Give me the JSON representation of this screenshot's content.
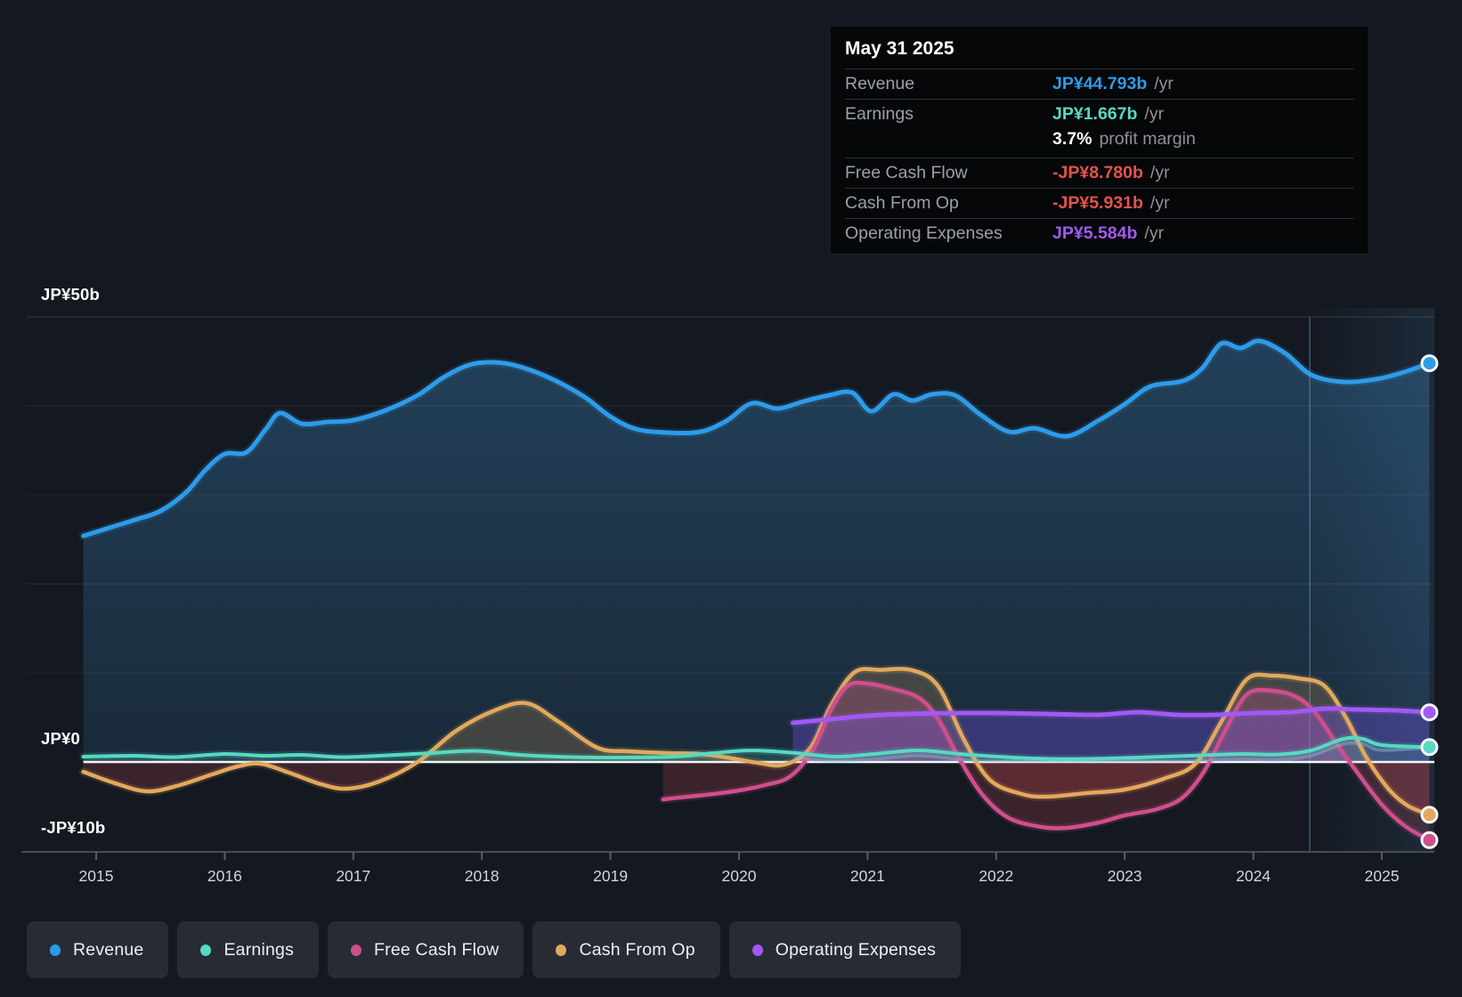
{
  "tooltip": {
    "date": "May 31 2025",
    "rows": [
      {
        "key": "revenue",
        "label": "Revenue",
        "value": "JP¥44.793b",
        "suffix": "/yr",
        "color": "#2e9be9",
        "joined": false
      },
      {
        "key": "earnings",
        "label": "Earnings",
        "value": "JP¥1.667b",
        "suffix": "/yr",
        "color": "#57d9c2",
        "joined": false
      },
      {
        "key": "profit-margin",
        "label": "",
        "value": "3.7%",
        "suffix": "profit margin",
        "color": "#ffffff",
        "joined": true
      },
      {
        "key": "free-cash-flow",
        "label": "Free Cash Flow",
        "value": "-JP¥8.780b",
        "suffix": "/yr",
        "color": "#e4534d",
        "joined": false
      },
      {
        "key": "cash-from-op",
        "label": "Cash From Op",
        "value": "-JP¥5.931b",
        "suffix": "/yr",
        "color": "#e4534d",
        "joined": false
      },
      {
        "key": "operating-expenses",
        "label": "Operating Expenses",
        "value": "JP¥5.584b",
        "suffix": "/yr",
        "color": "#a259f2",
        "joined": false
      }
    ]
  },
  "y_axis": {
    "labels": [
      {
        "text": "JP¥50b",
        "value": 50
      },
      {
        "text": "JP¥0",
        "value": 0
      },
      {
        "text": "-JP¥10b",
        "value": -10
      }
    ]
  },
  "x_axis": {
    "years": [
      "2015",
      "2016",
      "2017",
      "2018",
      "2019",
      "2020",
      "2021",
      "2022",
      "2023",
      "2024",
      "2025"
    ]
  },
  "legend": {
    "items": [
      {
        "key": "revenue",
        "label": "Revenue",
        "color": "#2e9be9"
      },
      {
        "key": "earnings",
        "label": "Earnings",
        "color": "#57d9c2"
      },
      {
        "key": "free-cash-flow",
        "label": "Free Cash Flow",
        "color": "#ce4f8c"
      },
      {
        "key": "cash-from-op",
        "label": "Cash From Op",
        "color": "#e2a85c"
      },
      {
        "key": "operating-expenses",
        "label": "Operating Expenses",
        "color": "#a259f2"
      }
    ]
  },
  "chart_data": {
    "type": "area",
    "unit": "JP¥ billions per year",
    "x_range": [
      2014.9,
      2025.42
    ],
    "ylim": [
      -10.1,
      50
    ],
    "y_gridline_values": [
      50,
      40,
      30,
      20,
      10,
      0,
      -10
    ],
    "y_tick_labels": [
      "JP¥50b",
      "JP¥0",
      "-JP¥10b"
    ],
    "x_tick_labels": [
      "2015",
      "2016",
      "2017",
      "2018",
      "2019",
      "2020",
      "2021",
      "2022",
      "2023",
      "2024",
      "2025"
    ],
    "grid": true,
    "legend_position": "bottom",
    "forecast_divider_x": 2024.44,
    "end_marker_x": 2025.37,
    "series": [
      {
        "name": "Revenue",
        "color": "#2e9be9",
        "points": [
          [
            2014.9,
            25.4
          ],
          [
            2015.1,
            26.3
          ],
          [
            2015.3,
            27.2
          ],
          [
            2015.5,
            28.2
          ],
          [
            2015.7,
            30.3
          ],
          [
            2015.85,
            32.8
          ],
          [
            2016.0,
            34.6
          ],
          [
            2016.17,
            34.8
          ],
          [
            2016.32,
            37.4
          ],
          [
            2016.43,
            39.2
          ],
          [
            2016.6,
            38.0
          ],
          [
            2016.8,
            38.2
          ],
          [
            2017.0,
            38.4
          ],
          [
            2017.25,
            39.5
          ],
          [
            2017.5,
            41.2
          ],
          [
            2017.7,
            43.2
          ],
          [
            2017.9,
            44.6
          ],
          [
            2018.1,
            44.9
          ],
          [
            2018.3,
            44.4
          ],
          [
            2018.55,
            43.0
          ],
          [
            2018.8,
            41.0
          ],
          [
            2019.0,
            38.8
          ],
          [
            2019.2,
            37.4
          ],
          [
            2019.45,
            37.0
          ],
          [
            2019.7,
            37.1
          ],
          [
            2019.9,
            38.3
          ],
          [
            2020.1,
            40.3
          ],
          [
            2020.3,
            39.7
          ],
          [
            2020.5,
            40.5
          ],
          [
            2020.7,
            41.2
          ],
          [
            2020.88,
            41.5
          ],
          [
            2021.03,
            39.4
          ],
          [
            2021.2,
            41.3
          ],
          [
            2021.35,
            40.6
          ],
          [
            2021.5,
            41.3
          ],
          [
            2021.68,
            41.2
          ],
          [
            2021.88,
            39.0
          ],
          [
            2022.1,
            37.1
          ],
          [
            2022.3,
            37.5
          ],
          [
            2022.55,
            36.6
          ],
          [
            2022.8,
            38.4
          ],
          [
            2023.0,
            40.2
          ],
          [
            2023.2,
            42.2
          ],
          [
            2023.45,
            42.8
          ],
          [
            2023.6,
            44.2
          ],
          [
            2023.75,
            47.0
          ],
          [
            2023.9,
            46.5
          ],
          [
            2024.05,
            47.3
          ],
          [
            2024.25,
            45.9
          ],
          [
            2024.45,
            43.5
          ],
          [
            2024.7,
            42.7
          ],
          [
            2024.95,
            43.0
          ],
          [
            2025.15,
            43.7
          ],
          [
            2025.37,
            44.793
          ]
        ]
      },
      {
        "name": "Earnings",
        "color": "#57d9c2",
        "points": [
          [
            2014.9,
            0.6
          ],
          [
            2015.3,
            0.7
          ],
          [
            2015.6,
            0.55
          ],
          [
            2016.0,
            0.9
          ],
          [
            2016.3,
            0.7
          ],
          [
            2016.6,
            0.8
          ],
          [
            2016.9,
            0.55
          ],
          [
            2017.2,
            0.7
          ],
          [
            2017.6,
            1.0
          ],
          [
            2017.95,
            1.25
          ],
          [
            2018.3,
            0.8
          ],
          [
            2018.7,
            0.55
          ],
          [
            2019.1,
            0.5
          ],
          [
            2019.5,
            0.6
          ],
          [
            2019.8,
            1.0
          ],
          [
            2020.1,
            1.3
          ],
          [
            2020.45,
            1.0
          ],
          [
            2020.75,
            0.6
          ],
          [
            2021.05,
            0.9
          ],
          [
            2021.4,
            1.3
          ],
          [
            2021.8,
            0.8
          ],
          [
            2022.3,
            0.4
          ],
          [
            2022.7,
            0.35
          ],
          [
            2023.1,
            0.5
          ],
          [
            2023.5,
            0.7
          ],
          [
            2023.9,
            0.9
          ],
          [
            2024.2,
            0.85
          ],
          [
            2024.45,
            1.3
          ],
          [
            2024.7,
            2.6
          ],
          [
            2024.85,
            2.6
          ],
          [
            2025.0,
            1.9
          ],
          [
            2025.37,
            1.667
          ]
        ]
      },
      {
        "name": "Free Cash Flow",
        "color": "#ce4f8c",
        "points": [
          [
            2019.41,
            -4.2
          ],
          [
            2019.6,
            -3.9
          ],
          [
            2019.8,
            -3.6
          ],
          [
            2020.0,
            -3.2
          ],
          [
            2020.2,
            -2.6
          ],
          [
            2020.4,
            -1.6
          ],
          [
            2020.58,
            1.5
          ],
          [
            2020.72,
            6.0
          ],
          [
            2020.85,
            8.6
          ],
          [
            2021.0,
            8.8
          ],
          [
            2021.2,
            8.2
          ],
          [
            2021.4,
            7.2
          ],
          [
            2021.55,
            4.8
          ],
          [
            2021.72,
            0.2
          ],
          [
            2021.9,
            -3.8
          ],
          [
            2022.1,
            -6.3
          ],
          [
            2022.35,
            -7.3
          ],
          [
            2022.55,
            -7.4
          ],
          [
            2022.8,
            -6.8
          ],
          [
            2023.0,
            -6.0
          ],
          [
            2023.25,
            -5.3
          ],
          [
            2023.45,
            -4.0
          ],
          [
            2023.62,
            -1.0
          ],
          [
            2023.78,
            3.5
          ],
          [
            2023.95,
            7.6
          ],
          [
            2024.15,
            8.0
          ],
          [
            2024.35,
            7.2
          ],
          [
            2024.5,
            5.2
          ],
          [
            2024.65,
            2.0
          ],
          [
            2024.8,
            -1.0
          ],
          [
            2025.0,
            -4.8
          ],
          [
            2025.18,
            -7.2
          ],
          [
            2025.37,
            -8.78
          ]
        ]
      },
      {
        "name": "Cash From Op",
        "color": "#e2a85c",
        "points": [
          [
            2014.9,
            -1.1
          ],
          [
            2015.15,
            -2.4
          ],
          [
            2015.4,
            -3.3
          ],
          [
            2015.65,
            -2.6
          ],
          [
            2015.9,
            -1.4
          ],
          [
            2016.1,
            -0.5
          ],
          [
            2016.28,
            -0.2
          ],
          [
            2016.5,
            -1.2
          ],
          [
            2016.75,
            -2.5
          ],
          [
            2016.95,
            -3.0
          ],
          [
            2017.2,
            -2.2
          ],
          [
            2017.5,
            0.0
          ],
          [
            2017.8,
            3.5
          ],
          [
            2018.1,
            5.8
          ],
          [
            2018.35,
            6.6
          ],
          [
            2018.6,
            4.5
          ],
          [
            2018.9,
            1.6
          ],
          [
            2019.15,
            1.2
          ],
          [
            2019.45,
            1.0
          ],
          [
            2019.7,
            0.9
          ],
          [
            2019.95,
            0.4
          ],
          [
            2020.15,
            -0.1
          ],
          [
            2020.35,
            -0.3
          ],
          [
            2020.55,
            1.5
          ],
          [
            2020.72,
            6.5
          ],
          [
            2020.9,
            10.1
          ],
          [
            2021.1,
            10.35
          ],
          [
            2021.35,
            10.3
          ],
          [
            2021.55,
            8.5
          ],
          [
            2021.75,
            2.5
          ],
          [
            2021.95,
            -2.0
          ],
          [
            2022.2,
            -3.6
          ],
          [
            2022.4,
            -3.9
          ],
          [
            2022.7,
            -3.5
          ],
          [
            2023.0,
            -3.1
          ],
          [
            2023.3,
            -1.9
          ],
          [
            2023.55,
            -0.2
          ],
          [
            2023.75,
            4.5
          ],
          [
            2023.95,
            9.3
          ],
          [
            2024.15,
            9.7
          ],
          [
            2024.35,
            9.4
          ],
          [
            2024.55,
            8.6
          ],
          [
            2024.72,
            5.0
          ],
          [
            2024.88,
            0.5
          ],
          [
            2025.05,
            -3.0
          ],
          [
            2025.2,
            -4.9
          ],
          [
            2025.37,
            -5.931
          ]
        ]
      },
      {
        "name": "Operating Expenses",
        "color": "#a259f2",
        "points": [
          [
            2020.42,
            4.4
          ],
          [
            2020.7,
            4.8
          ],
          [
            2021.0,
            5.2
          ],
          [
            2021.3,
            5.4
          ],
          [
            2021.7,
            5.5
          ],
          [
            2022.0,
            5.5
          ],
          [
            2022.4,
            5.4
          ],
          [
            2022.8,
            5.3
          ],
          [
            2023.1,
            5.6
          ],
          [
            2023.4,
            5.3
          ],
          [
            2023.7,
            5.3
          ],
          [
            2024.0,
            5.5
          ],
          [
            2024.3,
            5.6
          ],
          [
            2024.55,
            6.0
          ],
          [
            2024.8,
            5.9
          ],
          [
            2025.1,
            5.8
          ],
          [
            2025.37,
            5.584
          ]
        ]
      }
    ]
  }
}
